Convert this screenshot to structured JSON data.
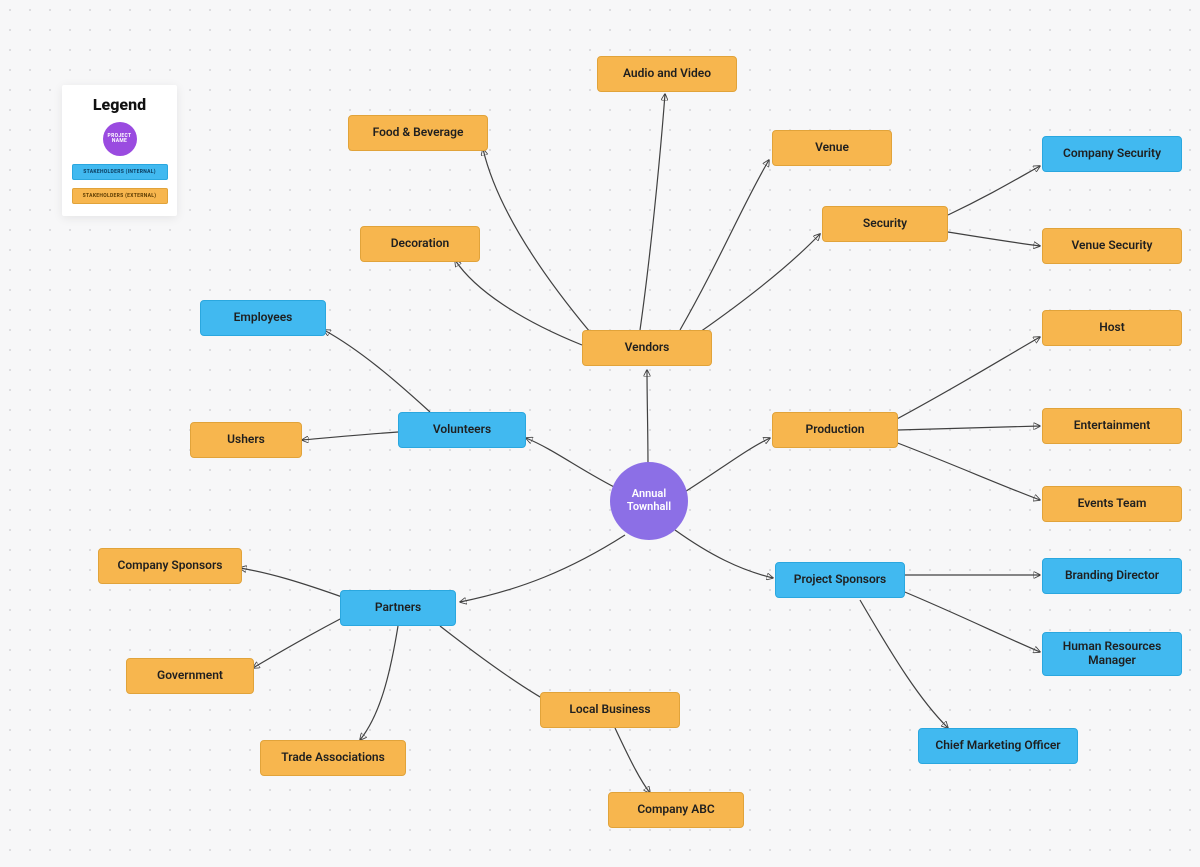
{
  "center": {
    "label": "Annual Townhall"
  },
  "legend": {
    "title": "Legend",
    "project": "PROJECT NAME",
    "internal": "STAKEHOLDERS (INTERNAL)",
    "external": "STAKEHOLDERS (EXTERNAL)"
  },
  "nodes": {
    "vendors": "Vendors",
    "food_bev": "Food & Beverage",
    "audio_video": "Audio and Video",
    "venue": "Venue",
    "decoration": "Decoration",
    "security": "Security",
    "company_security": "Company Security",
    "venue_security": "Venue Security",
    "production": "Production",
    "host": "Host",
    "entertainment": "Entertainment",
    "events_team": "Events Team",
    "project_sponsors": "Project Sponsors",
    "branding_director": "Branding Director",
    "hr_manager": "Human Resources Manager",
    "cmo": "Chief Marketing Officer",
    "volunteers": "Volunteers",
    "employees": "Employees",
    "ushers": "Ushers",
    "partners": "Partners",
    "company_sponsors": "Company Sponsors",
    "government": "Government",
    "trade_assoc": "Trade Associations",
    "local_business": "Local Business",
    "company_abc": "Company ABC"
  }
}
